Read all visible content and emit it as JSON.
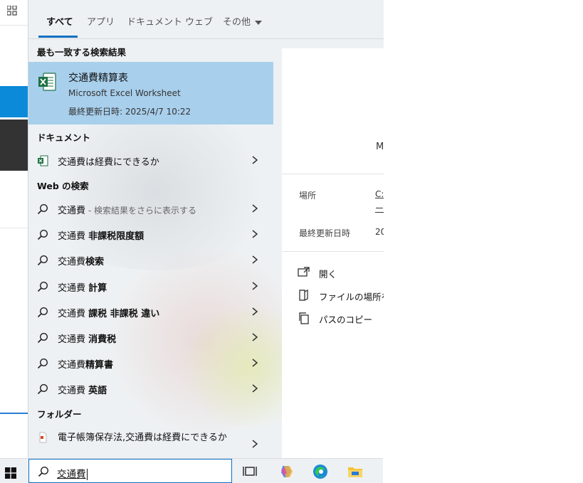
{
  "tabs": [
    {
      "label": "すべて",
      "active": true
    },
    {
      "label": "アプリ"
    },
    {
      "label": "ドキュメント"
    },
    {
      "label": "ウェブ"
    },
    {
      "label": "その他"
    }
  ],
  "best_match": {
    "heading": "最も一致する検索結果",
    "title": "交通費精算表",
    "type": "Microsoft Excel Worksheet",
    "modified": "最終更新日時: 2025/4/7 10:22",
    "icon": "excel-icon"
  },
  "documents": {
    "heading": "ドキュメント",
    "items": [
      {
        "label": "交通費は経費にできるか",
        "icon": "excel-icon"
      }
    ]
  },
  "web": {
    "heading": "Web の検索",
    "items": [
      {
        "prefix": "交通費",
        "bold": "",
        "sub": " - 検索結果をさらに表示する"
      },
      {
        "prefix": "交通費 ",
        "bold": "非課税限度額",
        "sub": ""
      },
      {
        "prefix": "交通費",
        "bold": "検索",
        "sub": ""
      },
      {
        "prefix": "交通費 ",
        "bold": "計算",
        "sub": ""
      },
      {
        "prefix": "交通費 ",
        "bold": "課税 非課税 違い",
        "sub": ""
      },
      {
        "prefix": "交通費 ",
        "bold": "消費税",
        "sub": ""
      },
      {
        "prefix": "交通費",
        "bold": "精算書",
        "sub": ""
      },
      {
        "prefix": "交通費 ",
        "bold": "英語",
        "sub": ""
      }
    ]
  },
  "folders": {
    "heading": "フォルダー",
    "items": [
      {
        "label": "電子帳簿保存法,交通費は経費にできるか"
      }
    ]
  },
  "preview": {
    "letter": "M",
    "location_label": "場所",
    "location_value": "C:",
    "location_value2": "ー",
    "modified_label": "最終更新日時",
    "modified_value": "20",
    "actions": [
      {
        "label": "開く",
        "icon": "open-icon"
      },
      {
        "label": "ファイルの場所を開",
        "icon": "folder-location-icon"
      },
      {
        "label": "パスのコピー",
        "icon": "copy-icon"
      }
    ]
  },
  "taskbar": {
    "search_value": "交通費",
    "icons": [
      "windows-start-icon",
      "task-view-icon",
      "copilot-icon",
      "edge-icon",
      "file-explorer-icon"
    ]
  },
  "colors": {
    "accent": "#0a6fc2",
    "best_match_bg": "#a8cfec",
    "excel_green": "#1e7145"
  }
}
